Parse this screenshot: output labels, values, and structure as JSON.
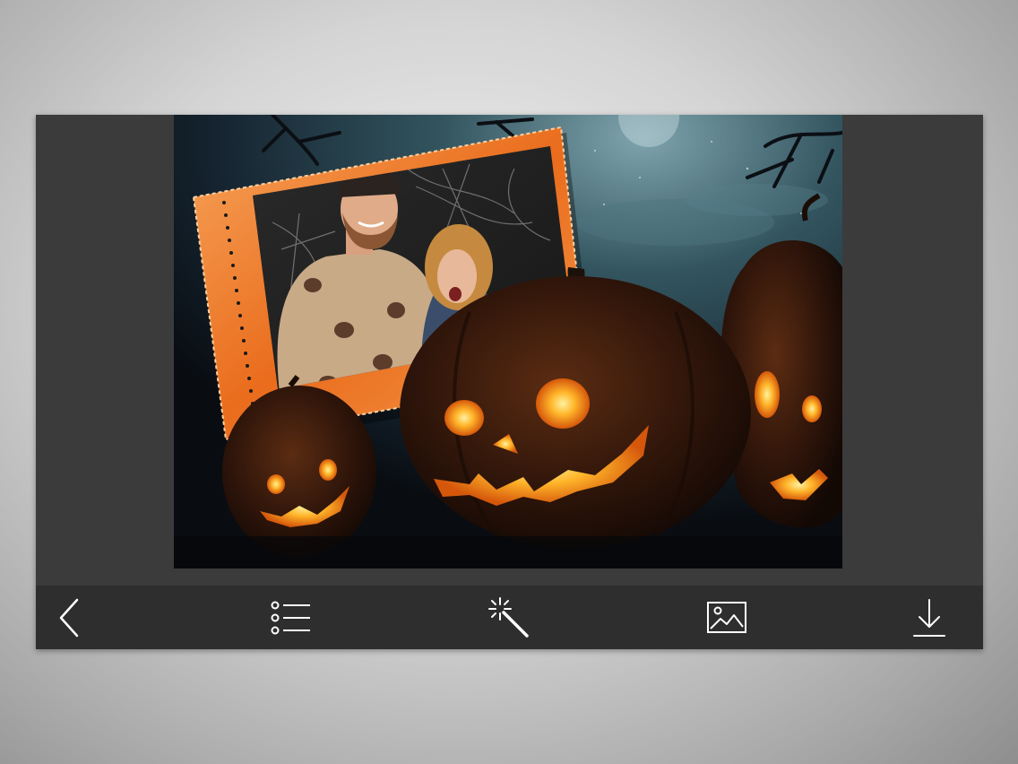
{
  "app": {
    "accent": "#f07a21",
    "toolbar_bg": "#2e2e2e",
    "icon_color": "#ffffff"
  },
  "canvas": {
    "scene": "halloween-pumpkin-night",
    "frame_style": "orange-stamp-frame"
  },
  "toolbar": {
    "items": [
      {
        "name": "back",
        "icon": "chevron-left-icon"
      },
      {
        "name": "frames",
        "icon": "list-icon"
      },
      {
        "name": "effects",
        "icon": "magic-wand-icon"
      },
      {
        "name": "gallery",
        "icon": "image-icon"
      },
      {
        "name": "download",
        "icon": "download-icon"
      }
    ]
  }
}
